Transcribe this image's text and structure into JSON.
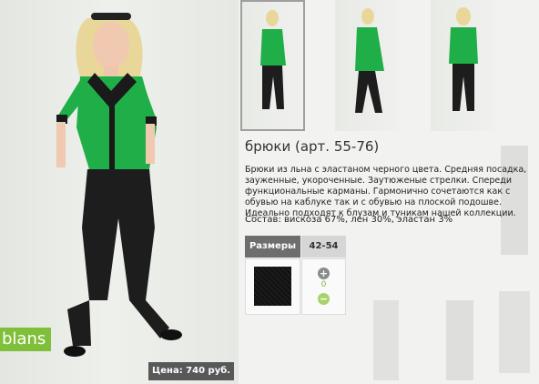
{
  "brand": {
    "logo_text": "blans"
  },
  "price": {
    "label": "Цена: 740 руб."
  },
  "product": {
    "title": "брюки (арт. 55-76)",
    "description": "Брюки из льна с эластаном черного цвета. Средняя посадка, зауженные, укороченные. Заутюженые стрелки. Спереди функциональные карманы. Гармонично сочетаются как с обувью  на каблуке так и с обувью на плоской подошве. Идеально подходят к блузам и туникам нашей коллекции.",
    "composition": "Состав: вискоза 67%, лен 30%, эластан 3%"
  },
  "sizes": {
    "header_label": "Размеры",
    "range": "42-54",
    "quantity": "0",
    "plus_symbol": "+",
    "minus_symbol": "−"
  },
  "colors": {
    "brand_green": "#7fbf3a",
    "blouse_green": "#1fae48",
    "price_bg": "#585858",
    "size_header_bg": "#6e6e6e"
  }
}
